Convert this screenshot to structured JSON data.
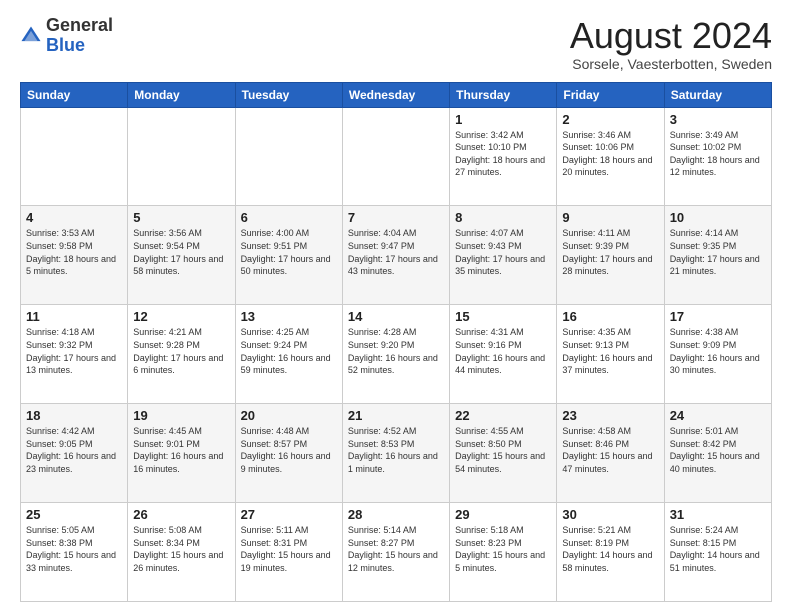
{
  "header": {
    "logo_general": "General",
    "logo_blue": "Blue",
    "month_title": "August 2024",
    "subtitle": "Sorsele, Vaesterbotten, Sweden"
  },
  "weekdays": [
    "Sunday",
    "Monday",
    "Tuesday",
    "Wednesday",
    "Thursday",
    "Friday",
    "Saturday"
  ],
  "weeks": [
    [
      {
        "day": "",
        "info": ""
      },
      {
        "day": "",
        "info": ""
      },
      {
        "day": "",
        "info": ""
      },
      {
        "day": "",
        "info": ""
      },
      {
        "day": "1",
        "info": "Sunrise: 3:42 AM\nSunset: 10:10 PM\nDaylight: 18 hours\nand 27 minutes."
      },
      {
        "day": "2",
        "info": "Sunrise: 3:46 AM\nSunset: 10:06 PM\nDaylight: 18 hours\nand 20 minutes."
      },
      {
        "day": "3",
        "info": "Sunrise: 3:49 AM\nSunset: 10:02 PM\nDaylight: 18 hours\nand 12 minutes."
      }
    ],
    [
      {
        "day": "4",
        "info": "Sunrise: 3:53 AM\nSunset: 9:58 PM\nDaylight: 18 hours\nand 5 minutes."
      },
      {
        "day": "5",
        "info": "Sunrise: 3:56 AM\nSunset: 9:54 PM\nDaylight: 17 hours\nand 58 minutes."
      },
      {
        "day": "6",
        "info": "Sunrise: 4:00 AM\nSunset: 9:51 PM\nDaylight: 17 hours\nand 50 minutes."
      },
      {
        "day": "7",
        "info": "Sunrise: 4:04 AM\nSunset: 9:47 PM\nDaylight: 17 hours\nand 43 minutes."
      },
      {
        "day": "8",
        "info": "Sunrise: 4:07 AM\nSunset: 9:43 PM\nDaylight: 17 hours\nand 35 minutes."
      },
      {
        "day": "9",
        "info": "Sunrise: 4:11 AM\nSunset: 9:39 PM\nDaylight: 17 hours\nand 28 minutes."
      },
      {
        "day": "10",
        "info": "Sunrise: 4:14 AM\nSunset: 9:35 PM\nDaylight: 17 hours\nand 21 minutes."
      }
    ],
    [
      {
        "day": "11",
        "info": "Sunrise: 4:18 AM\nSunset: 9:32 PM\nDaylight: 17 hours\nand 13 minutes."
      },
      {
        "day": "12",
        "info": "Sunrise: 4:21 AM\nSunset: 9:28 PM\nDaylight: 17 hours\nand 6 minutes."
      },
      {
        "day": "13",
        "info": "Sunrise: 4:25 AM\nSunset: 9:24 PM\nDaylight: 16 hours\nand 59 minutes."
      },
      {
        "day": "14",
        "info": "Sunrise: 4:28 AM\nSunset: 9:20 PM\nDaylight: 16 hours\nand 52 minutes."
      },
      {
        "day": "15",
        "info": "Sunrise: 4:31 AM\nSunset: 9:16 PM\nDaylight: 16 hours\nand 44 minutes."
      },
      {
        "day": "16",
        "info": "Sunrise: 4:35 AM\nSunset: 9:13 PM\nDaylight: 16 hours\nand 37 minutes."
      },
      {
        "day": "17",
        "info": "Sunrise: 4:38 AM\nSunset: 9:09 PM\nDaylight: 16 hours\nand 30 minutes."
      }
    ],
    [
      {
        "day": "18",
        "info": "Sunrise: 4:42 AM\nSunset: 9:05 PM\nDaylight: 16 hours\nand 23 minutes."
      },
      {
        "day": "19",
        "info": "Sunrise: 4:45 AM\nSunset: 9:01 PM\nDaylight: 16 hours\nand 16 minutes."
      },
      {
        "day": "20",
        "info": "Sunrise: 4:48 AM\nSunset: 8:57 PM\nDaylight: 16 hours\nand 9 minutes."
      },
      {
        "day": "21",
        "info": "Sunrise: 4:52 AM\nSunset: 8:53 PM\nDaylight: 16 hours\nand 1 minute."
      },
      {
        "day": "22",
        "info": "Sunrise: 4:55 AM\nSunset: 8:50 PM\nDaylight: 15 hours\nand 54 minutes."
      },
      {
        "day": "23",
        "info": "Sunrise: 4:58 AM\nSunset: 8:46 PM\nDaylight: 15 hours\nand 47 minutes."
      },
      {
        "day": "24",
        "info": "Sunrise: 5:01 AM\nSunset: 8:42 PM\nDaylight: 15 hours\nand 40 minutes."
      }
    ],
    [
      {
        "day": "25",
        "info": "Sunrise: 5:05 AM\nSunset: 8:38 PM\nDaylight: 15 hours\nand 33 minutes."
      },
      {
        "day": "26",
        "info": "Sunrise: 5:08 AM\nSunset: 8:34 PM\nDaylight: 15 hours\nand 26 minutes."
      },
      {
        "day": "27",
        "info": "Sunrise: 5:11 AM\nSunset: 8:31 PM\nDaylight: 15 hours\nand 19 minutes."
      },
      {
        "day": "28",
        "info": "Sunrise: 5:14 AM\nSunset: 8:27 PM\nDaylight: 15 hours\nand 12 minutes."
      },
      {
        "day": "29",
        "info": "Sunrise: 5:18 AM\nSunset: 8:23 PM\nDaylight: 15 hours\nand 5 minutes."
      },
      {
        "day": "30",
        "info": "Sunrise: 5:21 AM\nSunset: 8:19 PM\nDaylight: 14 hours\nand 58 minutes."
      },
      {
        "day": "31",
        "info": "Sunrise: 5:24 AM\nSunset: 8:15 PM\nDaylight: 14 hours\nand 51 minutes."
      }
    ]
  ]
}
